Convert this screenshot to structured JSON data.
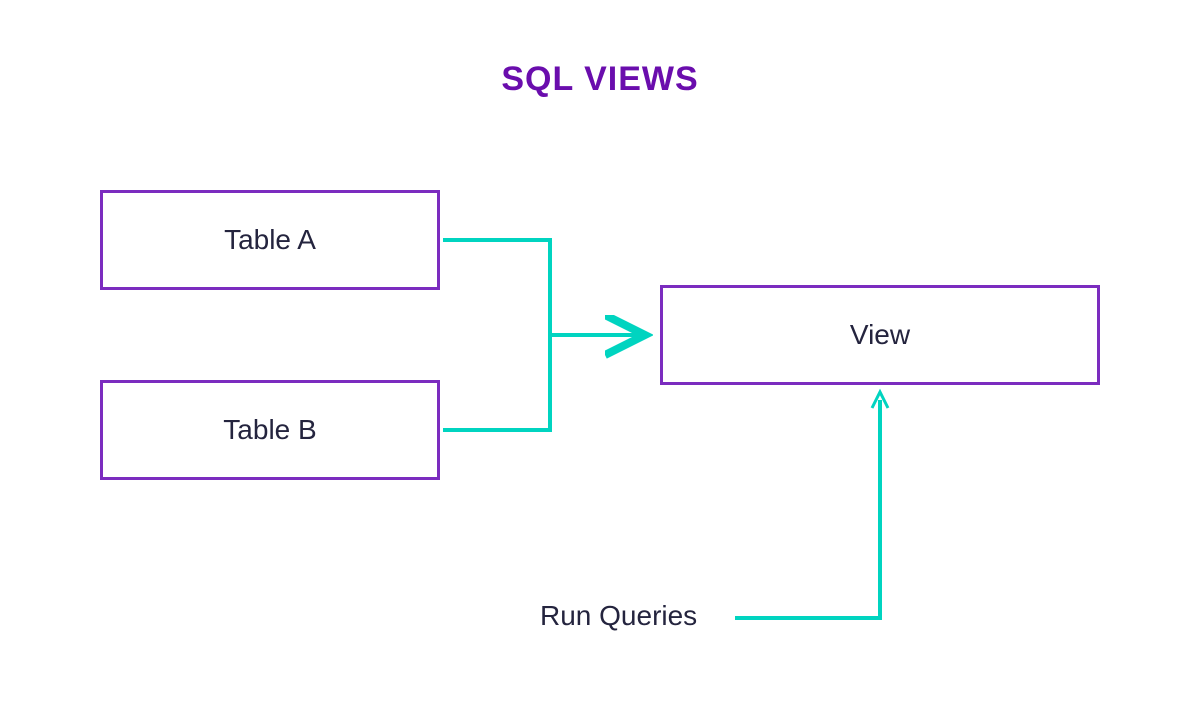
{
  "title": "SQL VIEWS",
  "boxes": {
    "tableA": "Table A",
    "tableB": "Table B",
    "view": "View"
  },
  "labels": {
    "runQueries": "Run Queries"
  },
  "colors": {
    "accent": "#6A0DAD",
    "border": "#7B2CBF",
    "text": "#24243e",
    "arrow": "#00D4C0"
  }
}
